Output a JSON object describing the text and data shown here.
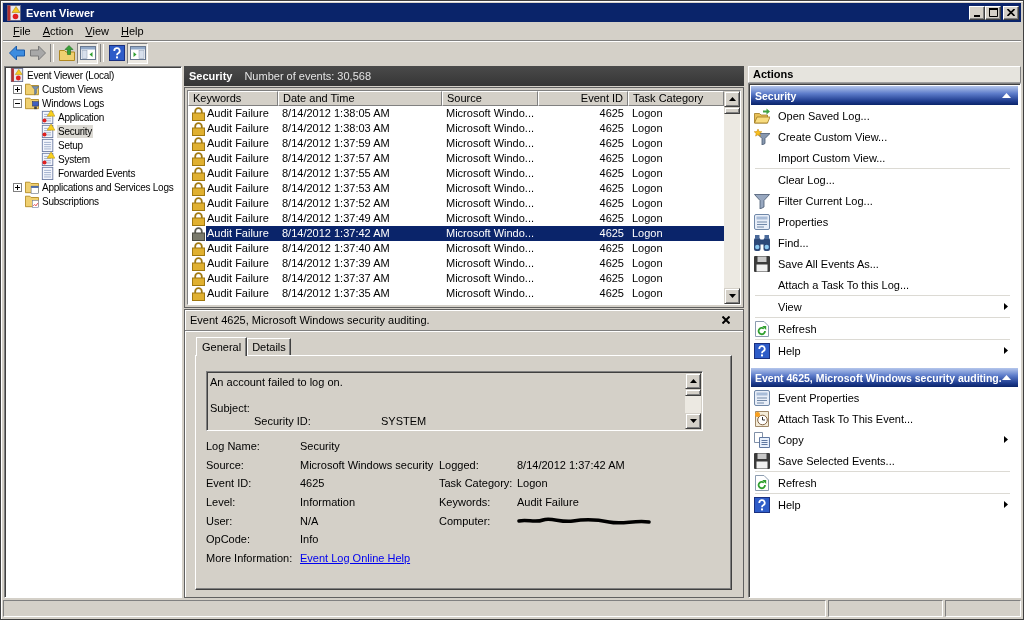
{
  "window": {
    "title": "Event Viewer"
  },
  "menu": [
    {
      "label": "File"
    },
    {
      "label": "Action"
    },
    {
      "label": "View"
    },
    {
      "label": "Help"
    }
  ],
  "toolbar": [
    [
      {
        "kind": "back",
        "disabled": false,
        "pressed": false
      },
      {
        "kind": "forward",
        "disabled": true,
        "pressed": false
      }
    ],
    [
      {
        "kind": "up",
        "disabled": false,
        "pressed": false
      },
      {
        "kind": "console-tree",
        "disabled": false,
        "pressed": true
      }
    ],
    [
      {
        "kind": "help",
        "disabled": false,
        "pressed": false
      },
      {
        "kind": "action-pane",
        "disabled": false,
        "pressed": true
      }
    ]
  ],
  "tree": [
    {
      "label": "Event Viewer (Local)",
      "kind": "root",
      "selected": false,
      "children": [
        {
          "label": "Custom Views",
          "kind": "folder-filter",
          "selected": false,
          "expanded": false
        },
        {
          "label": "Windows Logs",
          "kind": "folder-computer",
          "selected": false,
          "expanded": true,
          "children": [
            {
              "label": "Application",
              "kind": "log-alert",
              "selected": false
            },
            {
              "label": "Security",
              "kind": "log-alert",
              "selected": true
            },
            {
              "label": "Setup",
              "kind": "log",
              "selected": false
            },
            {
              "label": "System",
              "kind": "log-alert",
              "selected": false
            },
            {
              "label": "Forwarded Events",
              "kind": "log",
              "selected": false
            }
          ]
        },
        {
          "label": "Applications and Services Logs",
          "kind": "folder-window",
          "selected": false,
          "expanded": false
        },
        {
          "label": "Subscriptions",
          "kind": "folder-subscription",
          "selected": false
        }
      ]
    }
  ],
  "events": {
    "title": "Security",
    "count_label": "Number of events: 30,568",
    "columns": [
      {
        "label": "Keywords",
        "numeric": false
      },
      {
        "label": "Date and Time",
        "numeric": false
      },
      {
        "label": "Source",
        "numeric": false
      },
      {
        "label": "Event ID",
        "numeric": true
      },
      {
        "label": "Task Category",
        "numeric": false
      }
    ],
    "rows": [
      {
        "selected": false,
        "cells": [
          "Audit Failure",
          "8/14/2012 1:38:05 AM",
          "Microsoft Windo...",
          "4625",
          "Logon"
        ]
      },
      {
        "selected": false,
        "cells": [
          "Audit Failure",
          "8/14/2012 1:38:03 AM",
          "Microsoft Windo...",
          "4625",
          "Logon"
        ]
      },
      {
        "selected": false,
        "cells": [
          "Audit Failure",
          "8/14/2012 1:37:59 AM",
          "Microsoft Windo...",
          "4625",
          "Logon"
        ]
      },
      {
        "selected": false,
        "cells": [
          "Audit Failure",
          "8/14/2012 1:37:57 AM",
          "Microsoft Windo...",
          "4625",
          "Logon"
        ]
      },
      {
        "selected": false,
        "cells": [
          "Audit Failure",
          "8/14/2012 1:37:55 AM",
          "Microsoft Windo...",
          "4625",
          "Logon"
        ]
      },
      {
        "selected": false,
        "cells": [
          "Audit Failure",
          "8/14/2012 1:37:53 AM",
          "Microsoft Windo...",
          "4625",
          "Logon"
        ]
      },
      {
        "selected": false,
        "cells": [
          "Audit Failure",
          "8/14/2012 1:37:52 AM",
          "Microsoft Windo...",
          "4625",
          "Logon"
        ]
      },
      {
        "selected": false,
        "cells": [
          "Audit Failure",
          "8/14/2012 1:37:49 AM",
          "Microsoft Windo...",
          "4625",
          "Logon"
        ]
      },
      {
        "selected": true,
        "cells": [
          "Audit Failure",
          "8/14/2012 1:37:42 AM",
          "Microsoft Windo...",
          "4625",
          "Logon"
        ]
      },
      {
        "selected": false,
        "cells": [
          "Audit Failure",
          "8/14/2012 1:37:40 AM",
          "Microsoft Windo...",
          "4625",
          "Logon"
        ]
      },
      {
        "selected": false,
        "cells": [
          "Audit Failure",
          "8/14/2012 1:37:39 AM",
          "Microsoft Windo...",
          "4625",
          "Logon"
        ]
      },
      {
        "selected": false,
        "cells": [
          "Audit Failure",
          "8/14/2012 1:37:37 AM",
          "Microsoft Windo...",
          "4625",
          "Logon"
        ]
      },
      {
        "selected": false,
        "cells": [
          "Audit Failure",
          "8/14/2012 1:37:35 AM",
          "Microsoft Windo...",
          "4625",
          "Logon"
        ]
      }
    ]
  },
  "event_detail": {
    "title": "Event 4625, Microsoft Windows security auditing.",
    "tabs": [
      {
        "label": "General",
        "selected": true
      },
      {
        "label": "Details",
        "selected": false
      }
    ],
    "description": [
      {
        "text": "An account failed to log on."
      },
      {
        "text": "Subject:",
        "children": [
          {
            "label": "Security ID:",
            "value": "SYSTEM"
          }
        ]
      }
    ],
    "fields": [
      [
        {
          "label": "Log Name:",
          "value": "Security"
        }
      ],
      [
        {
          "label": "Source:",
          "value": "Microsoft Windows security"
        },
        {
          "label": "Logged:",
          "value": "8/14/2012 1:37:42 AM"
        }
      ],
      [
        {
          "label": "Event ID:",
          "value": "4625"
        },
        {
          "label": "Task Category:",
          "value": "Logon"
        }
      ],
      [
        {
          "label": "Level:",
          "value": "Information"
        },
        {
          "label": "Keywords:",
          "value": "Audit Failure"
        }
      ],
      [
        {
          "label": "User:",
          "value": "N/A"
        },
        {
          "label": "Computer:",
          "redacted": true
        }
      ],
      [
        {
          "label": "OpCode:",
          "value": "Info"
        }
      ],
      [
        {
          "label": "More Information:",
          "link": "Event Log Online Help"
        }
      ]
    ]
  },
  "actions": {
    "title": "Actions",
    "sections": [
      {
        "title": "Security",
        "expanded": true,
        "groups": [
          [
            {
              "label": "Open Saved Log...",
              "kind": "open",
              "submenu": false
            },
            {
              "label": "Create Custom View...",
              "kind": "new-filter",
              "submenu": false
            },
            {
              "label": "Import Custom View...",
              "kind": "none",
              "submenu": false
            }
          ],
          [
            {
              "label": "Clear Log...",
              "kind": "none",
              "submenu": false
            },
            {
              "label": "Filter Current Log...",
              "kind": "filter",
              "submenu": false
            },
            {
              "label": "Properties",
              "kind": "properties",
              "submenu": false
            },
            {
              "label": "Find...",
              "kind": "find",
              "submenu": false
            },
            {
              "label": "Save All Events As...",
              "kind": "save",
              "submenu": false
            },
            {
              "label": "Attach a Task To this Log...",
              "kind": "none",
              "submenu": false
            }
          ],
          [
            {
              "label": "View",
              "kind": "none",
              "submenu": true
            }
          ],
          [
            {
              "label": "Refresh",
              "kind": "refresh",
              "submenu": false
            }
          ],
          [
            {
              "label": "Help",
              "kind": "help",
              "submenu": true
            }
          ]
        ]
      },
      {
        "title": "Event 4625, Microsoft Windows security auditing.",
        "expanded": true,
        "groups": [
          [
            {
              "label": "Event Properties",
              "kind": "properties",
              "submenu": false
            },
            {
              "label": "Attach Task To This Event...",
              "kind": "task",
              "submenu": false
            },
            {
              "label": "Copy",
              "kind": "copy",
              "submenu": true
            },
            {
              "label": "Save Selected Events...",
              "kind": "save",
              "submenu": false
            }
          ],
          [
            {
              "label": "Refresh",
              "kind": "refresh",
              "submenu": false
            }
          ],
          [
            {
              "label": "Help",
              "kind": "help",
              "submenu": true
            }
          ]
        ]
      }
    ]
  }
}
